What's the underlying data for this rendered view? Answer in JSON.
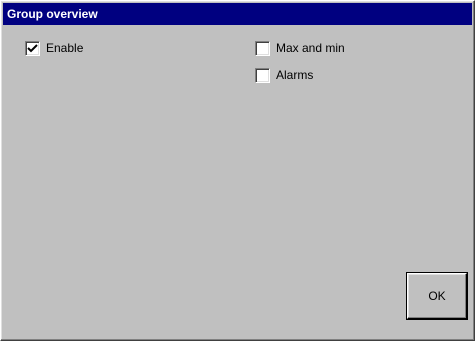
{
  "window": {
    "title": "Group overview"
  },
  "checkboxes": {
    "enable": {
      "label": "Enable",
      "checked": true
    },
    "max_and_min": {
      "label": "Max and min",
      "checked": false
    },
    "alarms": {
      "label": "Alarms",
      "checked": false
    }
  },
  "buttons": {
    "ok_label": "OK"
  },
  "colors": {
    "titlebar": "#000080",
    "face": "#c0c0c0"
  },
  "icons": {
    "checkmark": "check-icon"
  }
}
